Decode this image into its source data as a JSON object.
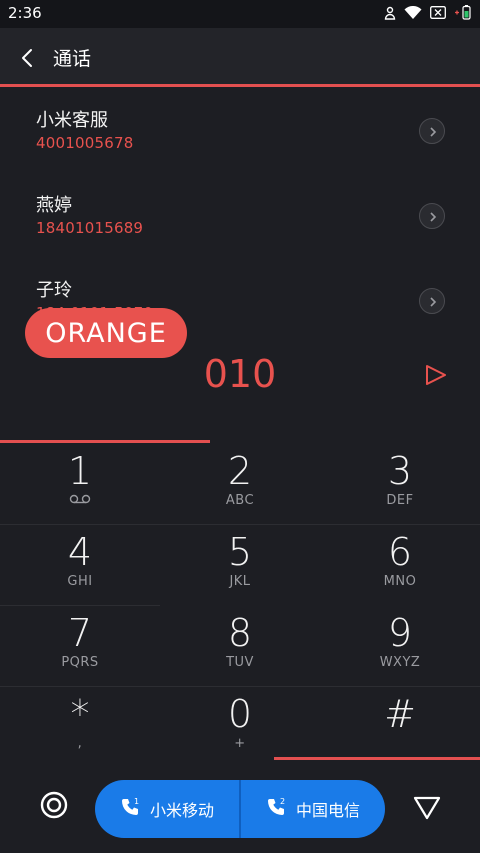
{
  "status_bar": {
    "time": "2:36"
  },
  "header": {
    "title": "通话"
  },
  "contacts": [
    {
      "name": "小米客服",
      "number": "4001005678"
    },
    {
      "name": "燕婷",
      "number": "18401015689"
    },
    {
      "name": "子玲",
      "number": "184 0101 5070"
    }
  ],
  "badge": {
    "label": "ORANGE"
  },
  "dialer": {
    "input": "010"
  },
  "keypad": [
    {
      "digit": "1",
      "letters": ""
    },
    {
      "digit": "2",
      "letters": "ABC"
    },
    {
      "digit": "3",
      "letters": "DEF"
    },
    {
      "digit": "4",
      "letters": "GHI"
    },
    {
      "digit": "5",
      "letters": "JKL"
    },
    {
      "digit": "6",
      "letters": "MNO"
    },
    {
      "digit": "7",
      "letters": "PQRS"
    },
    {
      "digit": "8",
      "letters": "TUV"
    },
    {
      "digit": "9",
      "letters": "WXYZ"
    },
    {
      "digit": "*",
      "letters": ","
    },
    {
      "digit": "0",
      "letters": "+"
    },
    {
      "digit": "#",
      "letters": ""
    }
  ],
  "sim": {
    "sim1_label": "小米移动",
    "sim2_label": "中国电信",
    "sim1_index": "1",
    "sim2_index": "2"
  },
  "colors": {
    "accent": "#e8524e",
    "call_button": "#1a7be8",
    "background": "#1d1e23"
  }
}
